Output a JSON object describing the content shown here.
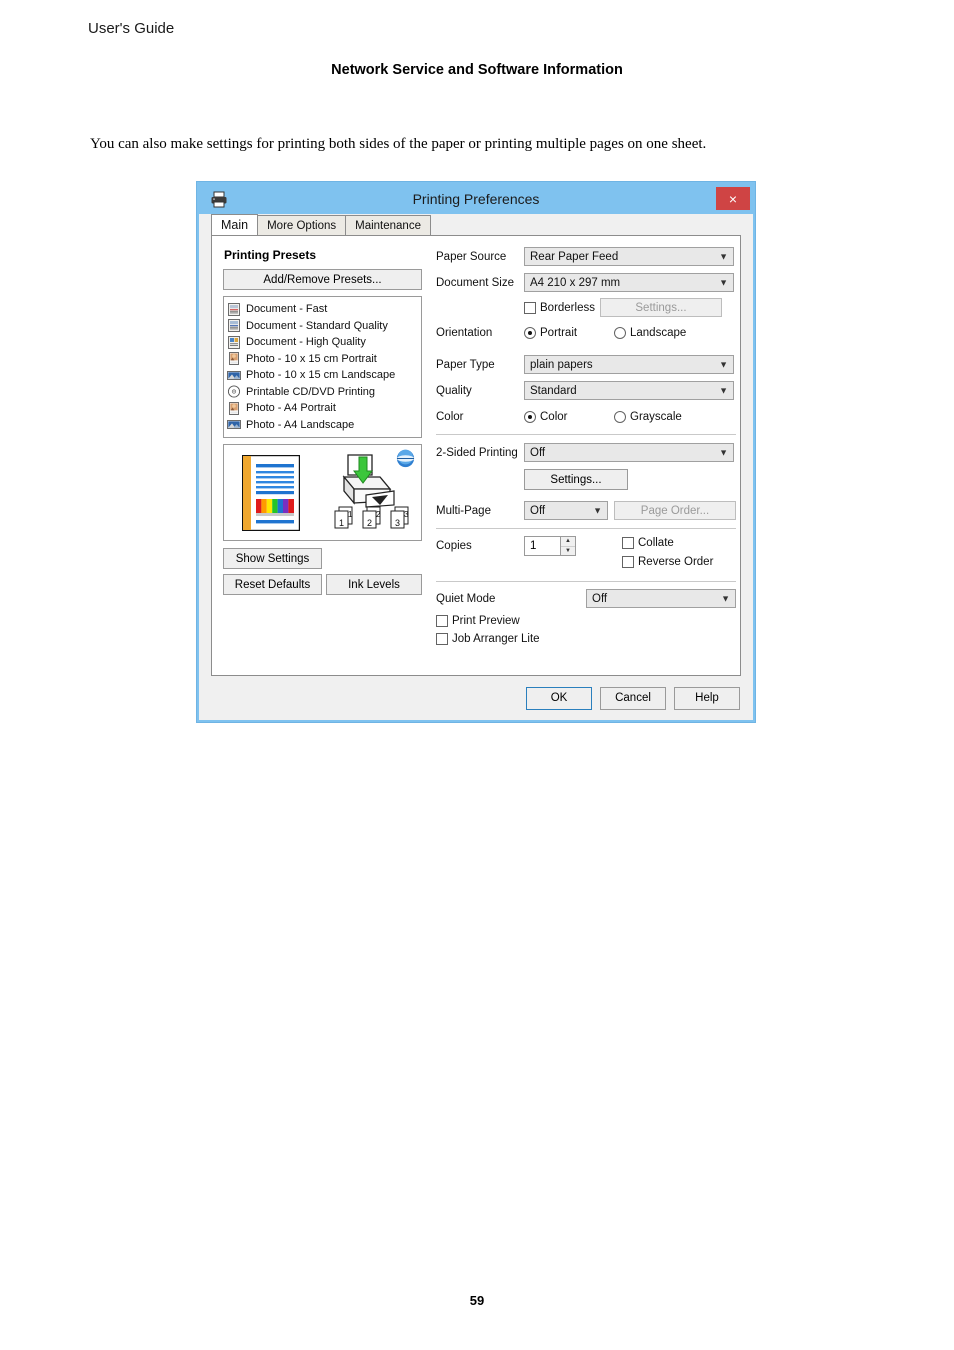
{
  "page": {
    "header": "User's Guide",
    "section_title": "Network Service and Software Information",
    "paragraph": "You can also make settings for printing both sides of the paper or printing multiple pages on one sheet.",
    "page_number": "59"
  },
  "dialog": {
    "title": "Printing Preferences",
    "close_label": "×",
    "titlebar_color": "#7fc2ef",
    "close_color": "#cf4444",
    "tabs": [
      {
        "label": "Main",
        "active": true
      },
      {
        "label": "More Options",
        "active": false
      },
      {
        "label": "Maintenance",
        "active": false
      }
    ],
    "left": {
      "presets_heading": "Printing Presets",
      "add_remove_label": "Add/Remove Presets...",
      "presets": [
        {
          "label": "Document - Fast",
          "icon": "document-fast-icon"
        },
        {
          "label": "Document - Standard Quality",
          "icon": "document-standard-icon"
        },
        {
          "label": "Document - High Quality",
          "icon": "document-high-icon"
        },
        {
          "label": "Photo - 10 x 15 cm Portrait",
          "icon": "photo-portrait-icon"
        },
        {
          "label": "Photo - 10 x 15 cm Landscape",
          "icon": "photo-landscape-icon"
        },
        {
          "label": "Printable CD/DVD Printing",
          "icon": "cd-dvd-icon"
        },
        {
          "label": "Photo - A4 Portrait",
          "icon": "photo-portrait-icon"
        },
        {
          "label": "Photo - A4 Landscape",
          "icon": "photo-landscape-icon"
        }
      ],
      "show_settings_label": "Show Settings",
      "reset_defaults_label": "Reset Defaults",
      "ink_levels_label": "Ink Levels",
      "preview": {
        "page_numbers": [
          "1",
          "2",
          "3"
        ]
      }
    },
    "right": {
      "paper_source": {
        "label": "Paper Source",
        "value": "Rear Paper Feed"
      },
      "document_size": {
        "label": "Document Size",
        "value": "A4 210 x 297 mm"
      },
      "borderless": {
        "label": "Borderless",
        "checked": false
      },
      "borderless_settings": {
        "label": "Settings...",
        "enabled": false
      },
      "orientation": {
        "label": "Orientation",
        "options": [
          "Portrait",
          "Landscape"
        ],
        "selected": "Portrait"
      },
      "paper_type": {
        "label": "Paper Type",
        "value": "plain papers"
      },
      "quality": {
        "label": "Quality",
        "value": "Standard"
      },
      "color": {
        "label": "Color",
        "options": [
          "Color",
          "Grayscale"
        ],
        "selected": "Color"
      },
      "two_sided": {
        "label": "2-Sided Printing",
        "value": "Off"
      },
      "two_sided_settings": {
        "label": "Settings...",
        "enabled": true
      },
      "multi_page": {
        "label": "Multi-Page",
        "value": "Off"
      },
      "page_order": {
        "label": "Page Order...",
        "enabled": false
      },
      "copies": {
        "label": "Copies",
        "value": "1"
      },
      "collate": {
        "label": "Collate",
        "checked": false
      },
      "reverse_order": {
        "label": "Reverse Order",
        "checked": false
      },
      "quiet_mode": {
        "label": "Quiet Mode",
        "value": "Off"
      },
      "print_preview": {
        "label": "Print Preview",
        "checked": false
      },
      "job_arranger": {
        "label": "Job Arranger Lite",
        "checked": false
      }
    },
    "footer": {
      "ok_label": "OK",
      "cancel_label": "Cancel",
      "help_label": "Help"
    }
  }
}
